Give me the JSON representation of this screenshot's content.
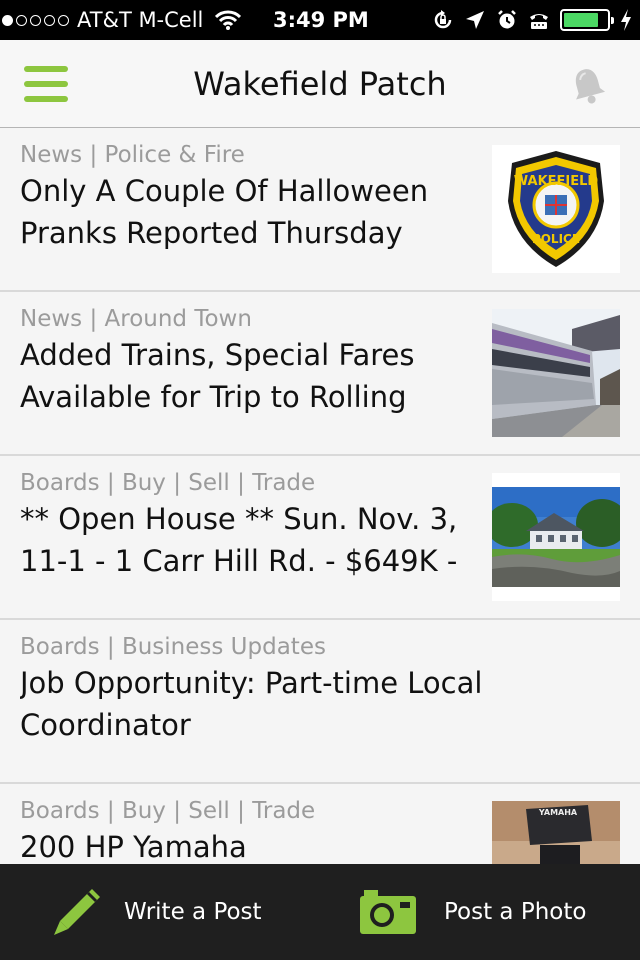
{
  "status_bar": {
    "carrier": "AT&T M-Cell",
    "time": "3:49 PM",
    "battery_level": 0.8,
    "signal_bars": 1
  },
  "nav": {
    "title": "Wakefield Patch",
    "icons": {
      "menu": "hamburger-menu-icon",
      "bell": "bell-icon"
    },
    "accent_color": "#8dc63f"
  },
  "feed": {
    "items": [
      {
        "category": "News | Police & Fire",
        "headline": "Only A Couple Of Halloween Pranks Reported Thursday",
        "thumb": {
          "text_top": "WAKEFIELD",
          "text_bottom": "POLICE",
          "icon": "police-badge"
        }
      },
      {
        "category": "News | Around Town",
        "headline": "Added Trains, Special Fares Available for Trip to Rolling",
        "thumb": {
          "icon": "train-photo"
        }
      },
      {
        "category": "Boards | Buy | Sell | Trade",
        "headline": "** Open House ** Sun. Nov. 3, 11-1 - 1 Carr Hill Rd. - $649K -",
        "thumb": {
          "icon": "house-photo"
        }
      },
      {
        "category": "Boards | Business Updates",
        "headline": "Job Opportunity: Part-time Local Coordinator",
        "thumb": null
      },
      {
        "category": "Boards | Buy | Sell | Trade",
        "headline": "200 HP Yamaha",
        "thumb": {
          "text_top": "YAMAHA",
          "icon": "outboard-motor-photo"
        }
      }
    ]
  },
  "bottom_bar": {
    "write_post_label": "Write a Post",
    "post_photo_label": "Post a Photo",
    "icons": {
      "write": "pencil-icon",
      "photo": "camera-icon"
    },
    "accent_color": "#8dc63f"
  }
}
